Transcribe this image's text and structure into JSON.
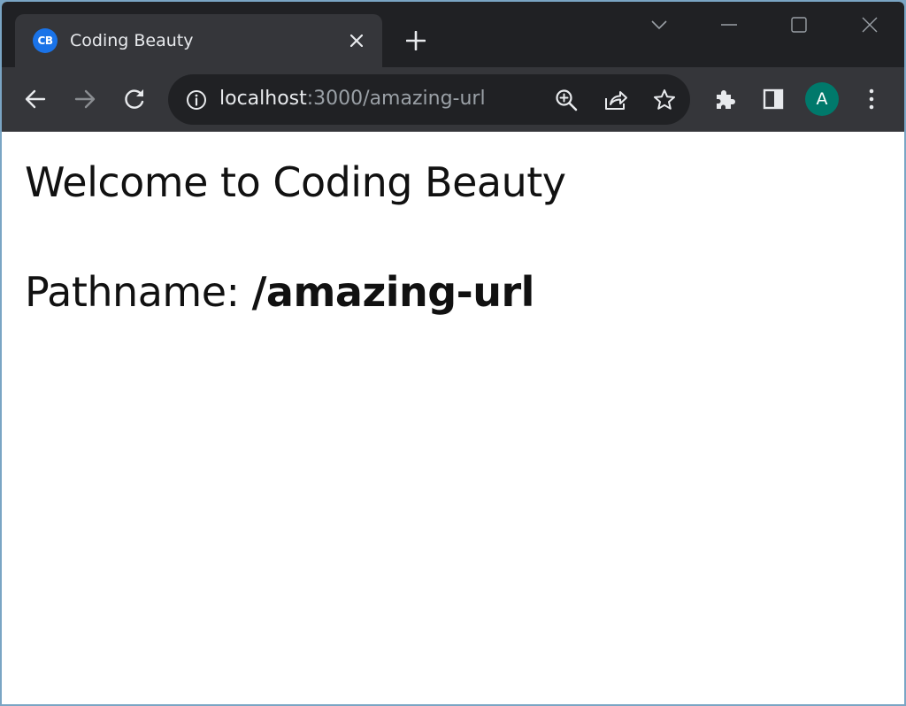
{
  "window": {
    "tab": {
      "favicon_text": "CB",
      "title": "Coding Beauty",
      "favicon_color": "#1a73e8"
    },
    "controls": [
      "tab-search-icon",
      "minimize-icon",
      "maximize-icon",
      "close-icon"
    ]
  },
  "toolbar": {
    "url_host": "localhost",
    "url_rest": ":3000/amazing-url",
    "profile_initial": "A",
    "profile_color": "#00796b",
    "icons": [
      "back-arrow-icon",
      "forward-arrow-icon",
      "reload-icon",
      "info-icon",
      "zoom-icon",
      "share-icon",
      "star-icon",
      "extensions-icon",
      "side-panel-icon",
      "menu-icon"
    ]
  },
  "page": {
    "heading": "Welcome to Coding Beauty",
    "path_label": "Pathname: ",
    "path_value": "/amazing-url"
  }
}
